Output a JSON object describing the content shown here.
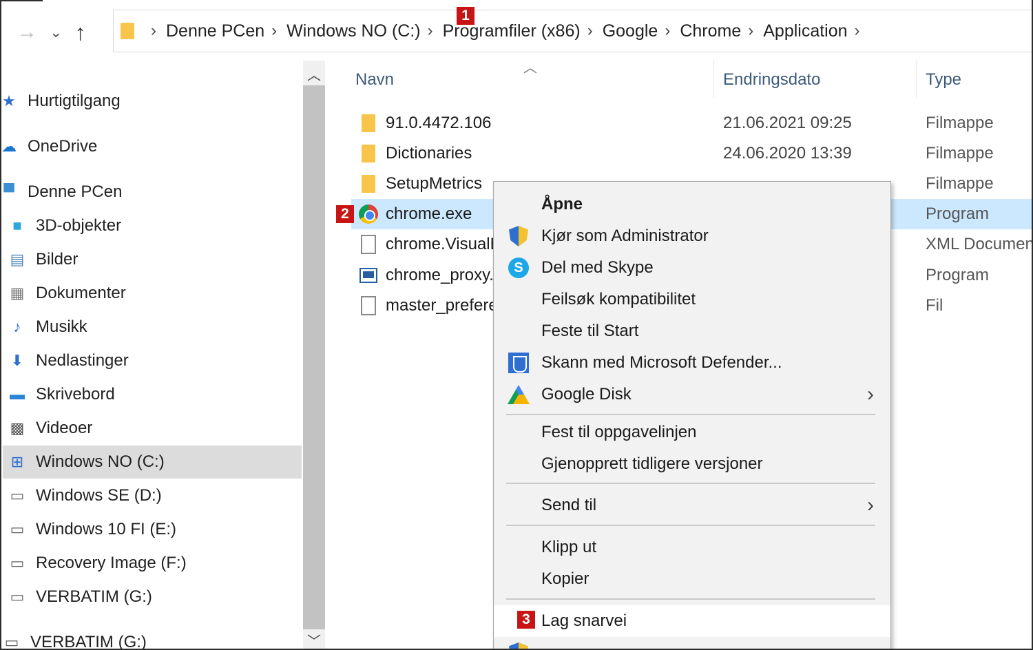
{
  "breadcrumb": [
    "Denne PCen",
    "Windows NO (C:)",
    "Programfiler (x86)",
    "Google",
    "Chrome",
    "Application"
  ],
  "badges": {
    "one": "1",
    "two": "2",
    "three": "3"
  },
  "sidebar": {
    "items": [
      {
        "label": "Hurtigtilgang",
        "icon": "star-icon"
      },
      {
        "label": "OneDrive",
        "icon": "cloud-icon"
      },
      {
        "label": "Denne PCen",
        "icon": "computer-icon"
      },
      {
        "label": "3D-objekter",
        "icon": "cube-icon"
      },
      {
        "label": "Bilder",
        "icon": "pictures-icon"
      },
      {
        "label": "Dokumenter",
        "icon": "documents-icon"
      },
      {
        "label": "Musikk",
        "icon": "music-icon"
      },
      {
        "label": "Nedlastinger",
        "icon": "download-icon"
      },
      {
        "label": "Skrivebord",
        "icon": "desktop-icon"
      },
      {
        "label": "Videoer",
        "icon": "video-icon"
      },
      {
        "label": "Windows NO (C:)",
        "icon": "drive-icon"
      },
      {
        "label": "Windows SE (D:)",
        "icon": "drive-icon"
      },
      {
        "label": "Windows 10 FI (E:)",
        "icon": "drive-icon"
      },
      {
        "label": "Recovery Image (F:)",
        "icon": "drive-icon"
      },
      {
        "label": "VERBATIM (G:)",
        "icon": "drive-icon"
      },
      {
        "label": "VERBATIM (G:)",
        "icon": "drive-icon"
      }
    ]
  },
  "columns": {
    "name": "Navn",
    "date": "Endringsdato",
    "type": "Type"
  },
  "files": [
    {
      "name": "91.0.4472.106",
      "date": "21.06.2021 09:25",
      "type": "Filmappe",
      "icon": "folder-icon"
    },
    {
      "name": "Dictionaries",
      "date": "24.06.2020 13:39",
      "type": "Filmappe",
      "icon": "folder-icon"
    },
    {
      "name": "SetupMetrics",
      "date": "",
      "type": "Filmappe",
      "icon": "folder-icon"
    },
    {
      "name": "chrome.exe",
      "date": "",
      "type": "Program",
      "icon": "chrome-icon"
    },
    {
      "name": "chrome.VisualElementsManifest.xml",
      "date": "",
      "type": "XML Document",
      "icon": "document-icon"
    },
    {
      "name": "chrome_proxy.exe",
      "date": "",
      "type": "Program",
      "icon": "application-icon"
    },
    {
      "name": "master_preferences",
      "date": "",
      "type": "Fil",
      "icon": "document-icon"
    }
  ],
  "context_menu": {
    "open": "Åpne",
    "run_admin": "Kjør som Administrator",
    "share_skype": "Del med Skype",
    "troubleshoot": "Feilsøk kompatibilitet",
    "pin_start": "Feste til Start",
    "scan_defender": "Skann med Microsoft Defender...",
    "google_drive": "Google Disk",
    "pin_taskbar": "Fest til oppgavelinjen",
    "restore_versions": "Gjenopprett tidligere versjoner",
    "send_to": "Send til",
    "cut": "Klipp ut",
    "copy": "Kopier",
    "create_shortcut": "Lag snarvei"
  },
  "colors": {
    "selection": "#cce8ff",
    "badge": "#c81414",
    "folder": "#f8c44c"
  }
}
